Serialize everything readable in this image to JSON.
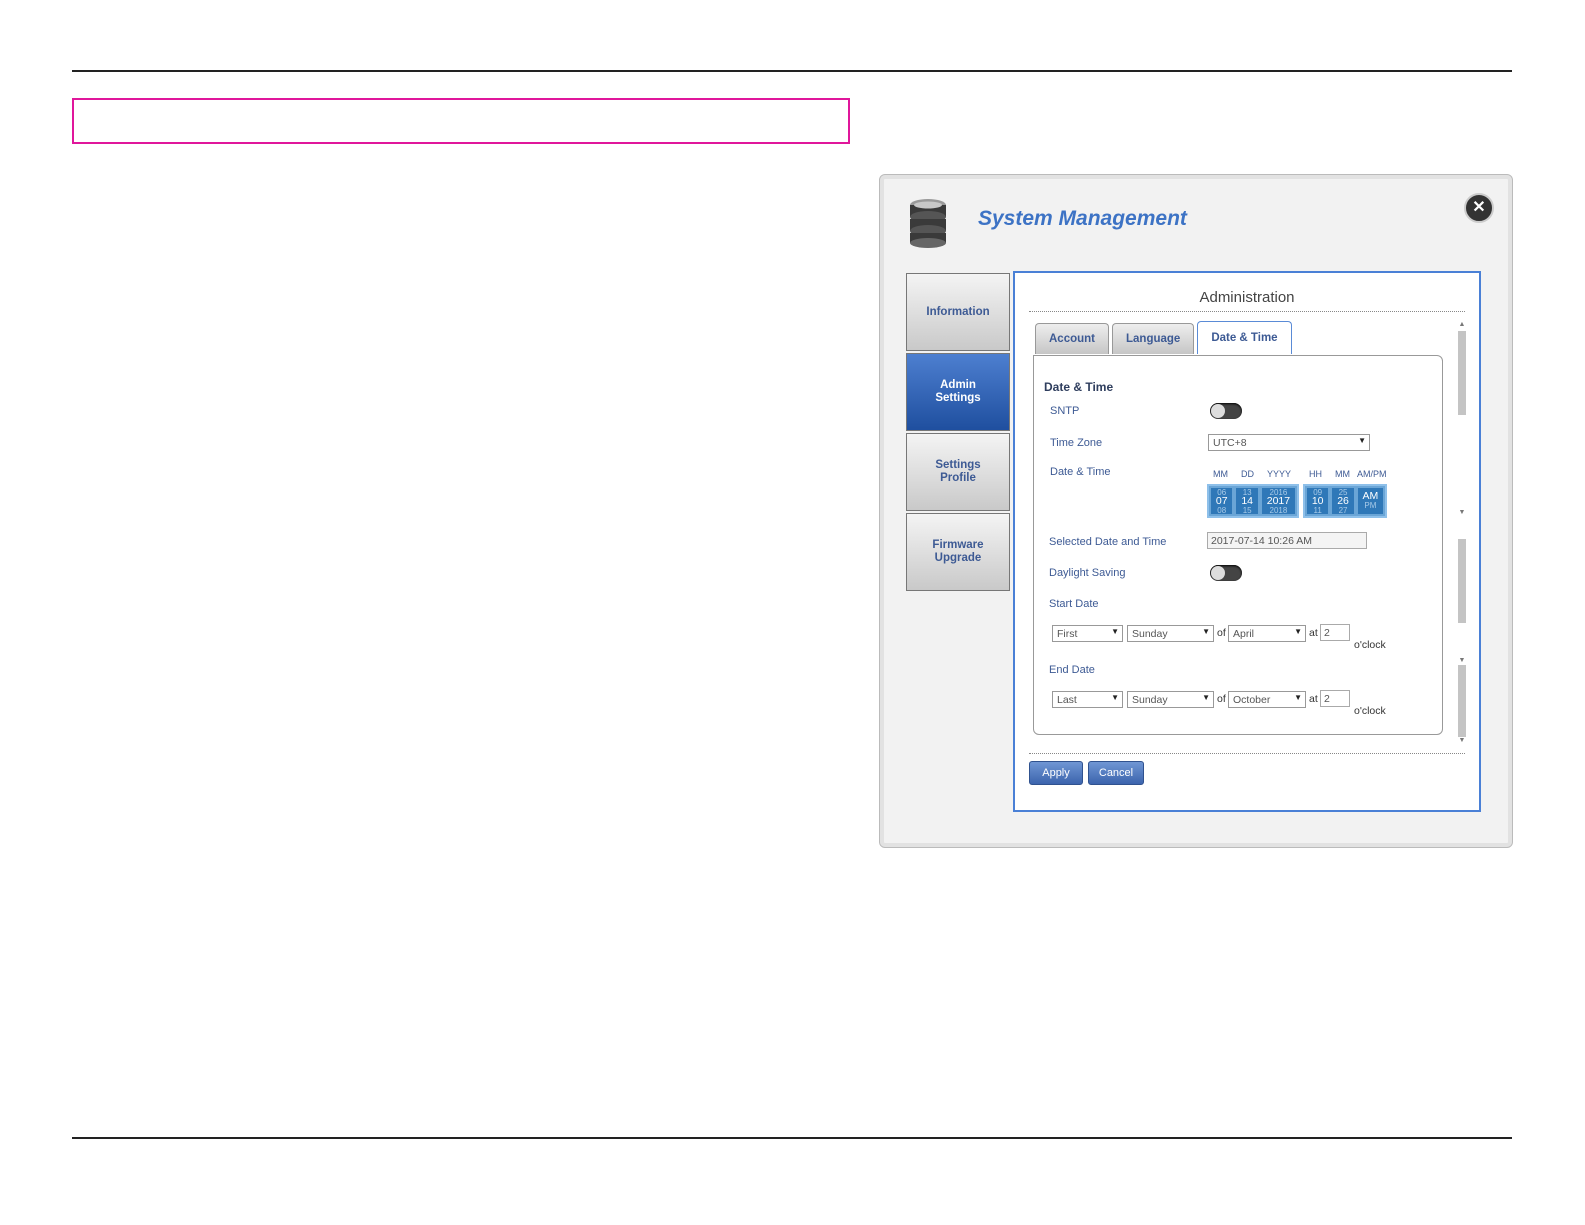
{
  "dialog": {
    "title": "System Management",
    "close_symbol": "✕"
  },
  "sidebar": {
    "items": [
      {
        "label": "Information"
      },
      {
        "label": "Admin\nSettings"
      },
      {
        "label": "Settings\nProfile"
      },
      {
        "label": "Firmware\nUpgrade"
      }
    ]
  },
  "panel": {
    "title": "Administration",
    "tabs": [
      {
        "label": "Account"
      },
      {
        "label": "Language"
      },
      {
        "label": "Date & Time"
      }
    ]
  },
  "form": {
    "section_heading": "Date & Time",
    "sntp_label": "SNTP",
    "sntp_enabled": false,
    "timezone_label": "Time Zone",
    "timezone_value": "UTC+8",
    "datetime_label": "Date & Time",
    "picker": {
      "headers": [
        "MM",
        "DD",
        "YYYY",
        "HH",
        "MM",
        "AM/PM"
      ],
      "month": {
        "prev": "06",
        "current": "07",
        "next": "08"
      },
      "day": {
        "prev": "13",
        "current": "14",
        "next": "15"
      },
      "year": {
        "prev": "2016",
        "current": "2017",
        "next": "2018"
      },
      "hour": {
        "prev": "09",
        "current": "10",
        "next": "11"
      },
      "minute": {
        "prev": "25",
        "current": "26",
        "next": "27"
      },
      "ampm": {
        "prev": "",
        "current": "AM",
        "next": "PM"
      }
    },
    "selected_label": "Selected Date and Time",
    "selected_value": "2017-07-14 10:26 AM",
    "daylight_label": "Daylight Saving",
    "daylight_enabled": false,
    "start_label": "Start Date",
    "start": {
      "week": "First",
      "day": "Sunday",
      "of": "of",
      "month": "April",
      "at": "at",
      "hour": "2",
      "oclock": "o'clock"
    },
    "end_label": "End Date",
    "end": {
      "week": "Last",
      "day": "Sunday",
      "of": "of",
      "month": "October",
      "at": "at",
      "hour": "2",
      "oclock": "o'clock"
    }
  },
  "buttons": {
    "apply": "Apply",
    "cancel": "Cancel"
  },
  "icons": [
    "database-icon",
    "close-icon",
    "dropdown-arrow-icon",
    "scroll-up-icon",
    "scroll-down-icon"
  ]
}
